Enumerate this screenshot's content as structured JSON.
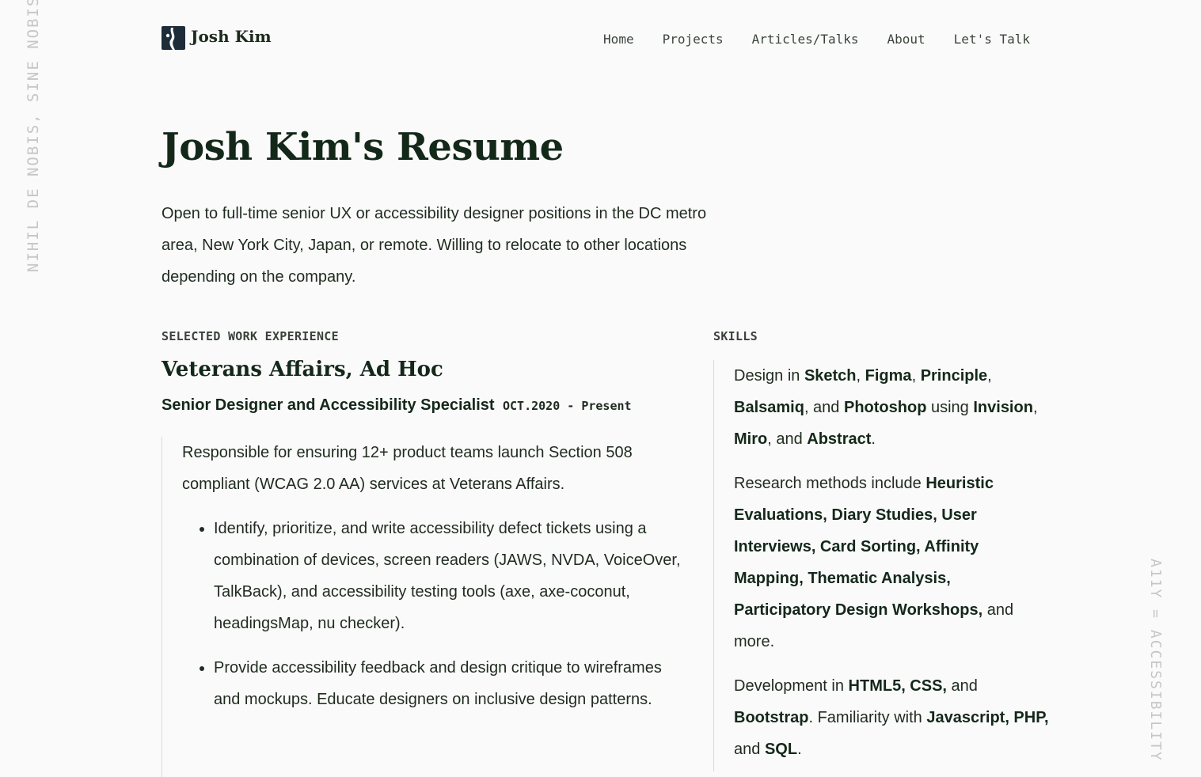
{
  "side_texts": {
    "left": "NIHIL DE NOBIS, SINE NOBIS",
    "right": "A11Y = ACCESSIBILITY"
  },
  "header": {
    "logo_text": "Josh Kim",
    "nav": [
      {
        "label": "Home"
      },
      {
        "label": "Projects"
      },
      {
        "label": "Articles/Talks"
      },
      {
        "label": "About"
      },
      {
        "label": "Let's Talk"
      }
    ]
  },
  "page": {
    "title": "Josh Kim's Resume",
    "intro": "Open to full-time senior UX or accessibility designer positions in the DC metro area, New York City, Japan, or remote. Willing to relocate to other locations depending on the company."
  },
  "work": {
    "section_label": "SELECTED WORK EXPERIENCE",
    "job": {
      "company": "Veterans Affairs, Ad Hoc",
      "title": "Senior Designer and Accessibility Specialist",
      "dates": "OCT.2020 - Present",
      "description": "Responsible for ensuring 12+ product teams launch Section 508 compliant (WCAG 2.0 AA) services at Veterans Affairs.",
      "bullets": [
        "Identify, prioritize, and write accessibility defect tickets using a combination of devices, screen readers (JAWS, NVDA, VoiceOver, TalkBack), and accessibility testing tools (axe, axe-coconut, headingsMap, nu checker).",
        "Provide accessibility feedback and design critique to wireframes and mockups. Educate designers on inclusive design patterns."
      ]
    }
  },
  "skills": {
    "section_label": "SKILLS",
    "paragraphs": [
      [
        {
          "t": "Design in "
        },
        {
          "t": "Sketch",
          "b": true
        },
        {
          "t": ", "
        },
        {
          "t": "Figma",
          "b": true
        },
        {
          "t": ", "
        },
        {
          "t": "Principle",
          "b": true
        },
        {
          "t": ", "
        },
        {
          "t": "Balsamiq",
          "b": true
        },
        {
          "t": ", and "
        },
        {
          "t": "Photoshop",
          "b": true
        },
        {
          "t": " using "
        },
        {
          "t": "Invision",
          "b": true
        },
        {
          "t": ", "
        },
        {
          "t": "Miro",
          "b": true
        },
        {
          "t": ", and "
        },
        {
          "t": "Abstract",
          "b": true
        },
        {
          "t": "."
        }
      ],
      [
        {
          "t": "Research methods include "
        },
        {
          "t": "Heuristic Evaluations, Diary Studies, User Interviews, Card Sorting, Affinity Mapping, Thematic Analysis, Participatory Design Workshops,",
          "b": true
        },
        {
          "t": " and more."
        }
      ],
      [
        {
          "t": "Development in "
        },
        {
          "t": "HTML5, CSS,",
          "b": true
        },
        {
          "t": " and "
        },
        {
          "t": "Bootstrap",
          "b": true
        },
        {
          "t": ". Familiarity with "
        },
        {
          "t": "Javascript, PHP,",
          "b": true
        },
        {
          "t": " and "
        },
        {
          "t": "SQL",
          "b": true
        },
        {
          "t": "."
        }
      ]
    ]
  }
}
